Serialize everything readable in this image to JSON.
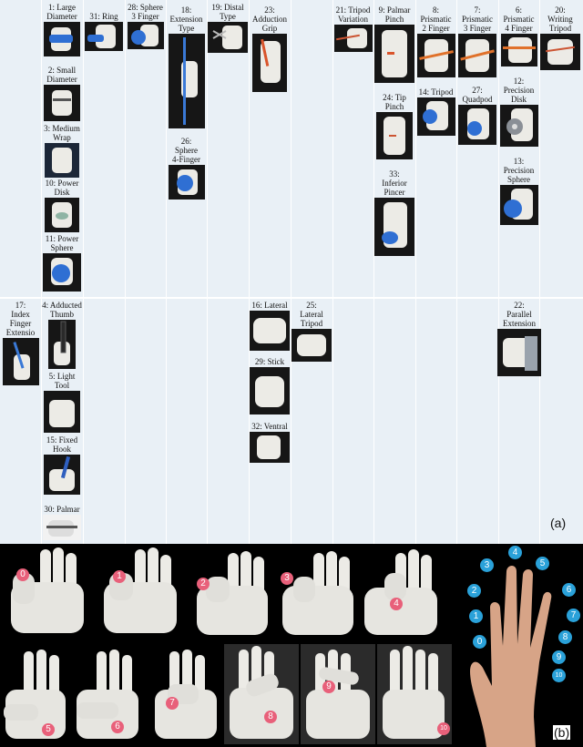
{
  "panel_a": {
    "label": "(a)",
    "grasps": [
      {
        "id": "g1",
        "label": "1: Large\nDiameter"
      },
      {
        "id": "g2",
        "label": "2: Small\nDiameter"
      },
      {
        "id": "g3",
        "label": "3: Medium\nWrap"
      },
      {
        "id": "g10",
        "label": "10: Power\nDisk"
      },
      {
        "id": "g11",
        "label": "11: Power\nSphere"
      },
      {
        "id": "g31",
        "label": "31: Ring"
      },
      {
        "id": "g28",
        "label": "28: Sphere\n3 Finger"
      },
      {
        "id": "g18",
        "label": "18:\nExtension\nType"
      },
      {
        "id": "g26",
        "label": "26:\nSphere\n4-Finger"
      },
      {
        "id": "g19",
        "label": "19: Distal\nType"
      },
      {
        "id": "g23",
        "label": "23:\nAdduction\nGrip"
      },
      {
        "id": "g21",
        "label": "21: Tripod\nVariation"
      },
      {
        "id": "g9",
        "label": "9: Palmar\nPinch"
      },
      {
        "id": "g24",
        "label": "24: Tip\nPinch"
      },
      {
        "id": "g33",
        "label": "33:\nInferior\nPincer"
      },
      {
        "id": "g8",
        "label": "8:\nPrismatic\n2 Finger"
      },
      {
        "id": "g14",
        "label": "14: Tripod"
      },
      {
        "id": "g7",
        "label": "7:\nPrismatic\n3 Finger"
      },
      {
        "id": "g27",
        "label": "27:\nQuadpod"
      },
      {
        "id": "g6",
        "label": "6:\nPrismatic\n4 Finger"
      },
      {
        "id": "g12",
        "label": "12:\nPrecision\nDisk"
      },
      {
        "id": "g13",
        "label": "13:\nPrecision\nSphere"
      },
      {
        "id": "g20",
        "label": "20:\nWriting\nTripod"
      },
      {
        "id": "g17",
        "label": "17:\nIndex\nFinger\nExtensio"
      },
      {
        "id": "g4",
        "label": "4: Adducted\nThumb"
      },
      {
        "id": "g5",
        "label": "5: Light\nTool"
      },
      {
        "id": "g15",
        "label": "15: Fixed\nHook"
      },
      {
        "id": "g30",
        "label": "30: Palmar"
      },
      {
        "id": "g16",
        "label": "16: Lateral"
      },
      {
        "id": "g29",
        "label": "29: Stick"
      },
      {
        "id": "g32",
        "label": "32: Ventral"
      },
      {
        "id": "g25",
        "label": "25:\nLateral\nTripod"
      },
      {
        "id": "g22",
        "label": "22:\nParallel\nExtension"
      }
    ]
  },
  "panel_b": {
    "label": "(b)",
    "pose_numbers": [
      "0",
      "1",
      "2",
      "3",
      "4",
      "5",
      "6",
      "7",
      "8",
      "9",
      "10"
    ],
    "hand_point_numbers": [
      "0",
      "1",
      "2",
      "3",
      "4",
      "5",
      "6",
      "7",
      "8",
      "9",
      "10"
    ],
    "colors": {
      "pose_marker": "#e8607a",
      "hand_marker": "#2aa1d9",
      "background": "#000000"
    }
  }
}
